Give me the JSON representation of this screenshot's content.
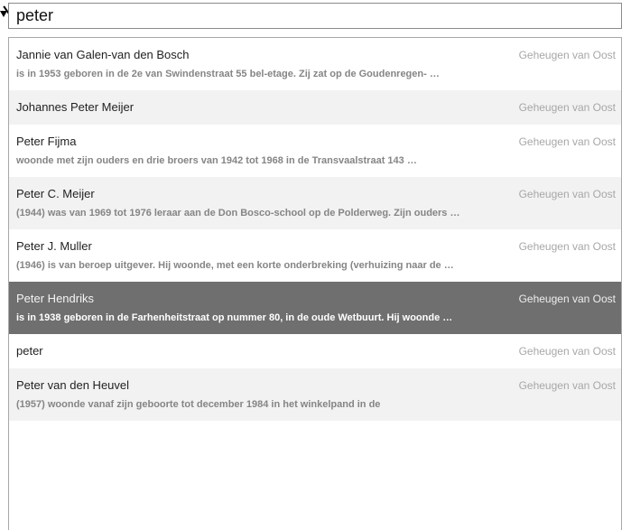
{
  "search": {
    "value": "peter"
  },
  "results": [
    {
      "name": "Jannie van Galen-van den Bosch",
      "source": "Geheugen van Oost",
      "description": "is in 1953 geboren in de 2e van Swindenstraat 55 bel-etage. Zij zat op de Goudenregen- …"
    },
    {
      "name": "Johannes Peter Meijer",
      "source": "Geheugen van Oost",
      "description": ""
    },
    {
      "name": "Peter Fijma",
      "source": "Geheugen van Oost",
      "description": "woonde met zijn ouders en drie broers van 1942 tot 1968 in de Transvaalstraat 143 …"
    },
    {
      "name": "Peter C. Meijer",
      "source": "Geheugen van Oost",
      "description": "(1944) was van 1969 tot 1976 leraar aan de Don Bosco-school op de Polderweg. Zijn ouders …"
    },
    {
      "name": "Peter J. Muller",
      "source": "Geheugen van Oost",
      "description": "(1946) is van beroep uitgever. Hij woonde, met een korte onderbreking (verhuizing naar de …"
    },
    {
      "name": "Peter Hendriks",
      "source": "Geheugen van Oost",
      "description": "is in 1938 geboren in de Farhenheitstraat op nummer 80, in de oude Wetbuurt. Hij woonde …",
      "selected": true
    },
    {
      "name": "peter",
      "source": "Geheugen van Oost",
      "description": ""
    },
    {
      "name": "Peter van den Heuvel",
      "source": "Geheugen van Oost",
      "description": "(1957) woonde vanaf zijn geboorte tot december 1984 in het winkelpand in de"
    }
  ]
}
